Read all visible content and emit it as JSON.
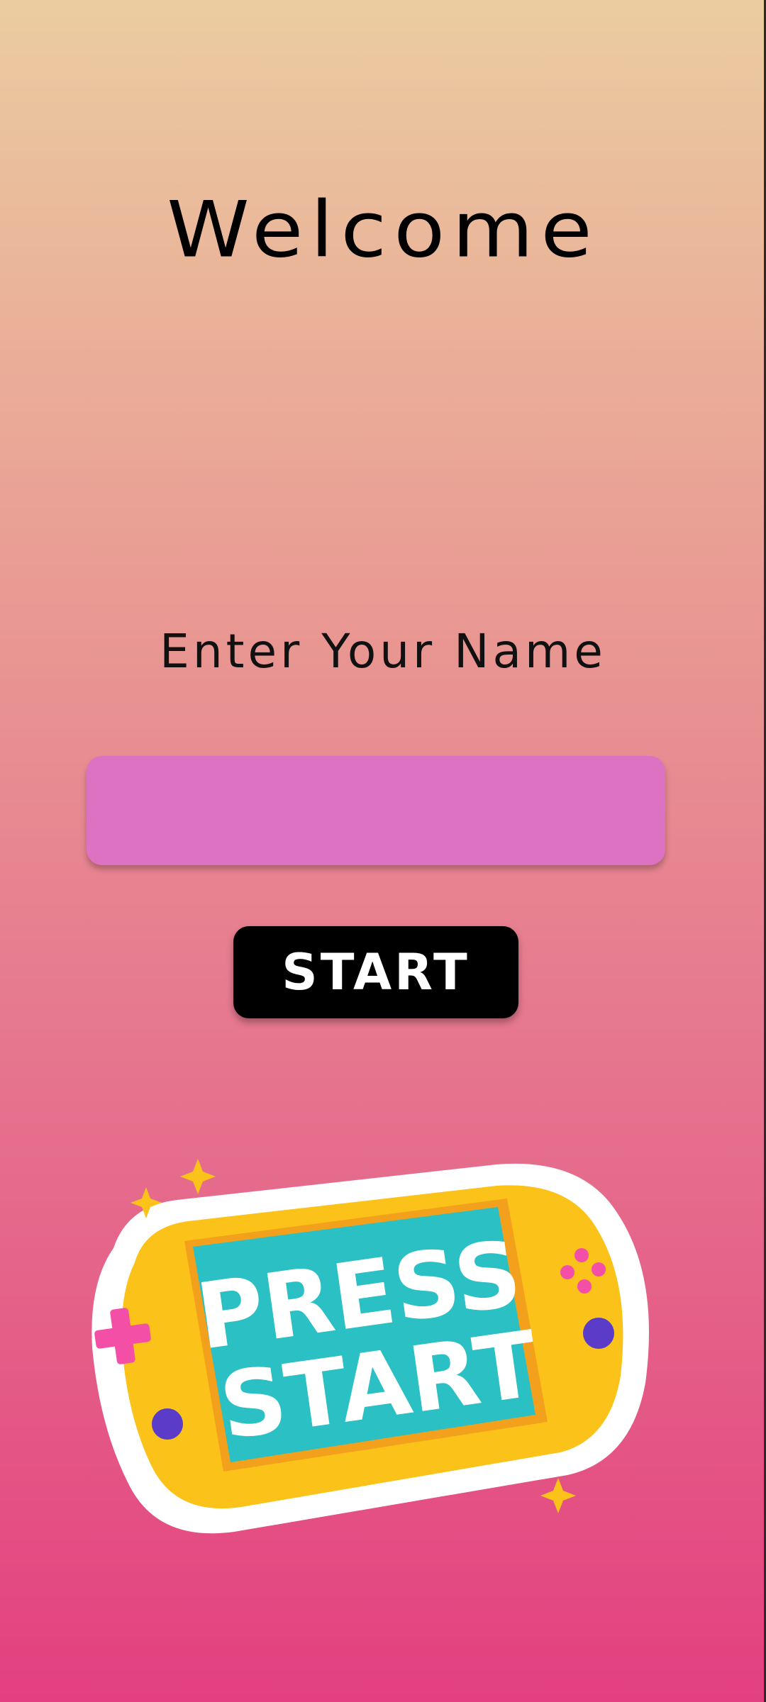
{
  "screen": {
    "title": "Welcome",
    "prompt": "Enter Your Name"
  },
  "name_input": {
    "value": "",
    "placeholder": ""
  },
  "start_button": {
    "label": "START"
  },
  "sticker": {
    "line1": "PRESS",
    "line2": "START",
    "icon": "handheld-console-icon"
  },
  "colors": {
    "gradient_top": "#ebcca0",
    "gradient_bottom": "#e3407f",
    "input_bg": "#de72c2",
    "button_bg": "#000000",
    "console_yellow": "#fbc21a",
    "screen_teal": "#2bc0c4",
    "accent_pink": "#f44fa6",
    "accent_purple": "#5a3cc8"
  }
}
